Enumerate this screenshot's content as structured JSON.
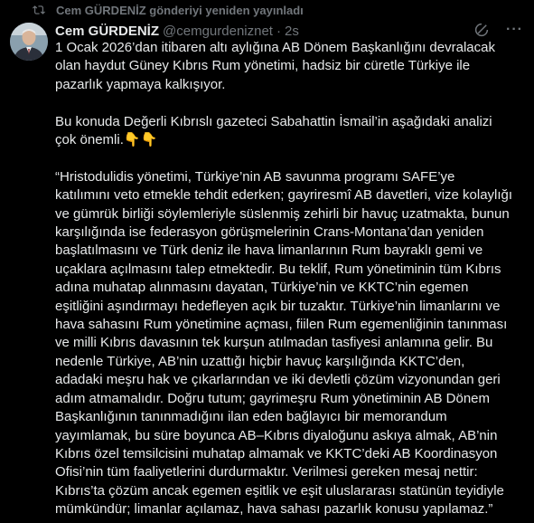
{
  "repost": {
    "label": "Cem GÜRDENİZ gönderiyi yeniden yayınladı",
    "icon": "repost-icon"
  },
  "author": {
    "name": "Cem GÜRDENİZ",
    "handle": "@cemgurdeniznet",
    "separator": "·",
    "time": "2s",
    "avatar_icon": "avatar"
  },
  "actions": {
    "grok_icon": "grok-icon",
    "more_label": "···"
  },
  "tweet": {
    "lines": [
      "1 Ocak 2026’dan itibaren altı aylığına AB Dönem Başkanlığını devralacak",
      "olan haydut Güney Kıbrıs  Rum yönetimi, hadsiz bir cüretle Türkiye ile",
      "pazarlık yapmaya kalkışıyor.",
      "",
      "Bu konuda Değerli Kıbrıslı gazeteci Sabahattin İsmail’in aşağıdaki analizi",
      "çok önemli.👇👇",
      "",
      "“Hristodulidis yönetimi, Türkiye’nin AB savunma programı SAFE’ye",
      "katılımını veto etmekle tehdit ederken; gayriresmî AB davetleri, vize kolaylığı",
      "ve gümrük birliği söylemleriyle süslenmiş zehirli bir havuç uzatmakta, bunun",
      "karşılığında ise federasyon görüşmelerinin Crans-Montana’dan yeniden",
      "başlatılmasını ve Türk deniz ile hava limanlarının Rum bayraklı gemi ve",
      "uçaklara açılmasını talep etmektedir. Bu teklif, Rum yönetiminin tüm Kıbrıs",
      "adına muhatap alınmasını dayatan, Türkiye’nin ve KKTC’nin egemen",
      "eşitliğini aşındırmayı hedefleyen açık bir tuzaktır. Türkiye’nin limanlarını ve",
      "hava sahasını Rum yönetimine açması, fiilen Rum egemenliğinin tanınması",
      "ve milli Kıbrıs davasının tek kurşun atılmadan tasfiyesi anlamına gelir. Bu",
      "nedenle Türkiye, AB’nin uzattığı hiçbir havuç karşılığında KKTC’den,",
      "adadaki meşru hak ve çıkarlarından ve iki devletli çözüm vizyonundan geri",
      "adım atmamalıdır. Doğru tutum; gayrimeşru Rum yönetiminin AB Dönem",
      "Başkanlığının tanınmadığını ilan eden bağlayıcı bir memorandum",
      "yayımlamak, bu süre boyunca AB–Kıbrıs diyaloğunu askıya almak, AB’nin",
      "Kıbrıs özel temsilcisini muhatap almamak ve KKTC’deki AB Koordinasyon",
      "Ofisi’nin tüm faaliyetlerini durdurmaktır. Verilmesi gereken mesaj nettir:",
      "Kıbrıs’ta çözüm ancak egemen eşitlik ve eşit uluslararası statünün teyidiyle",
      "mümkündür; limanlar açılamaz, hava sahası pazarlık konusu yapılamaz.”"
    ]
  }
}
